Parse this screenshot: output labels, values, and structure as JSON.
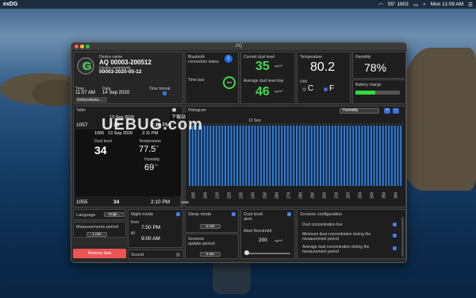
{
  "menubar": {
    "app_name": "exDG",
    "right_items": [
      "55° 1803",
      "Mon 11:09 AM"
    ]
  },
  "window": {
    "title": "AQ"
  },
  "device": {
    "name_label": "Device name",
    "name": "AQ 00003-200512",
    "comments_label": "Device comments",
    "comments": "00003-2020-05-12",
    "time_label": "Time",
    "time": "11:07 AM",
    "date_label": "Date",
    "date": "14 Sep 2020",
    "time_format_label": "Time format",
    "sync_label": "SYNCHRONI..."
  },
  "bluetooth": {
    "label": "Bluetooth connection status",
    "time_since_label": "Time last",
    "ring_text": "6m"
  },
  "dust": {
    "current_label": "Current dust level",
    "current_value": "35",
    "avg_label": "Average dust level day",
    "avg_value": "46",
    "unit": "ug/m³"
  },
  "temperature": {
    "label": "Temperature",
    "value": "80.2",
    "unit_label": "Unit",
    "unit_c": "C",
    "unit_f": "F",
    "selected_unit": "F"
  },
  "humidity": {
    "label": "Humidity",
    "value": "78%"
  },
  "battery": {
    "label": "Battery charge",
    "level": 0.45,
    "color": "#2fdc3c"
  },
  "table": {
    "title": "Table",
    "rows": [
      {
        "id": "1057",
        "date": "13 Sep 2020",
        "value": "34",
        "time": "2:12 PM"
      },
      {
        "id": "1055",
        "value": "34",
        "time": "2:10 PM"
      }
    ],
    "selected": {
      "id": "1056",
      "date": "13 Sep 2020",
      "time": "2:11 PM",
      "dust_label": "Dust level",
      "dust_value": "34",
      "temp_label": "Temperature",
      "temp_value": "77.5",
      "temp_unit": "°F",
      "hum_label": "Humidity",
      "hum_value": "69",
      "hum_unit": "%"
    }
  },
  "histogram": {
    "title": "Histogram",
    "date_label": "13 Sep",
    "selector": "Humidity",
    "plus": "+",
    "minus": "-",
    "bar_color": "#2b7de0",
    "x_ticks": [
      "190",
      "200",
      "210",
      "220",
      "230",
      "240",
      "250",
      "260",
      "270",
      "280",
      "290",
      "300",
      "310",
      "320",
      "330",
      "340",
      "350",
      "360"
    ]
  },
  "settings": {
    "language_label": "Language",
    "language_value": "Engli...",
    "measurement_label": "Measurements period",
    "measurement_value": "1 min",
    "remove_label": "Remove data",
    "night_label": "Night mode",
    "night_from": "from",
    "night_from_value": "7:50 PM",
    "night_till": "till",
    "night_till_value": "9:00 AM",
    "sound_label": "Sound",
    "sleep_label": "Sleep mode",
    "sleep_value": "5 min",
    "update_label": "Screens update period",
    "update_value": "5 sec",
    "alert_label": "Dust level alert",
    "alert_threshold_label": "Alert threshold",
    "alert_threshold_value": "200",
    "alert_unit": "ug/m³",
    "screens_title": "Screens configuration",
    "screens_items": [
      "Dust concentration live",
      "Minimum dust concentration during the measurement period",
      "Average dust concentration during the measurement period"
    ]
  },
  "watermark": {
    "text": "UEBUG.com",
    "cn": "下载站"
  }
}
